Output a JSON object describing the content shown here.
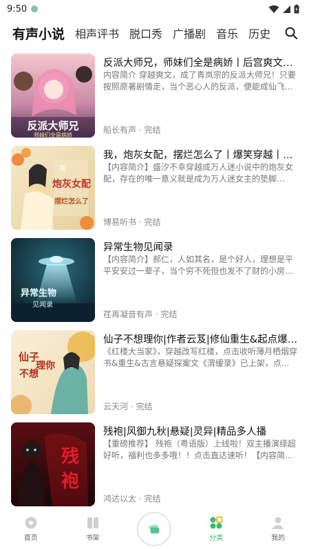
{
  "status": {
    "time": "9:50"
  },
  "tabs": [
    {
      "label": "有声小说",
      "active": true
    },
    {
      "label": "相声评书"
    },
    {
      "label": "脱口秀"
    },
    {
      "label": "广播剧"
    },
    {
      "label": "音乐"
    },
    {
      "label": "历史"
    }
  ],
  "items": [
    {
      "title": "反派大师兄，师妹们全是病娇丨后宫爽文丨...",
      "desc": "内容简介 穿越爽文，成了青岚宗的反派大师兄！只要按照原著剧情走，当个恶心人的反派，便能成仙飞...",
      "meta": "船长有声 · 完结",
      "cover_text": [
        "反派大师兄",
        "师妹们全是病娇"
      ]
    },
    {
      "title": "我，炮灰女配，摆烂怎么了丨爆笑穿越丨团...",
      "desc": "【内容简介】盛汐不幸穿越成万人迷小说中的炮灰女配，存在的唯一意义就是成为万人迷女主的垫脚石！...",
      "meta": "博易听书 · 完结",
      "cover_text": [
        "我",
        "炮灰女配",
        "摆烂怎么了"
      ]
    },
    {
      "title": "异常生物见闻录",
      "desc": "【内容简介】郝仁，人如其名，是个好人，理想是平平安安过一辈子，当个穷不死但也发不了财的小房东...",
      "meta": "荏苒凝音有声 · 完结",
      "cover_text": [
        "异常生物",
        "见闻录"
      ]
    },
    {
      "title": "仙子不想理你|作者云芨|修仙重生&起点爆款...",
      "desc": "《红楼大当家》，穿越改写红楼，点击收听薄月栖烟穿书&重生&古言悬疑探案文《渭缓录》已上架，点...",
      "meta": "云天河 · 完结",
      "cover_text": [
        "仙子",
        "不想",
        "理你"
      ]
    },
    {
      "title": "残袍|风御九秋|悬疑|灵异|精品多人播",
      "desc": "【重磅推荐】 残袍（粤语版）上线啦！双主播演绎超好听，福利也多多哦！！点击直达速听！【内容简...",
      "meta": "鸿达以太 · 完结",
      "cover_text": [
        "残",
        "袍"
      ]
    }
  ],
  "nav": [
    {
      "label": "首页",
      "icon": "home-disc-icon"
    },
    {
      "label": "书架",
      "icon": "bookshelf-icon"
    },
    {
      "label": "",
      "icon": "play-center-icon"
    },
    {
      "label": "分类",
      "icon": "category-icon",
      "active": true
    },
    {
      "label": "我的",
      "icon": "profile-icon"
    }
  ],
  "colors": {
    "accent": "#3cb87a"
  }
}
